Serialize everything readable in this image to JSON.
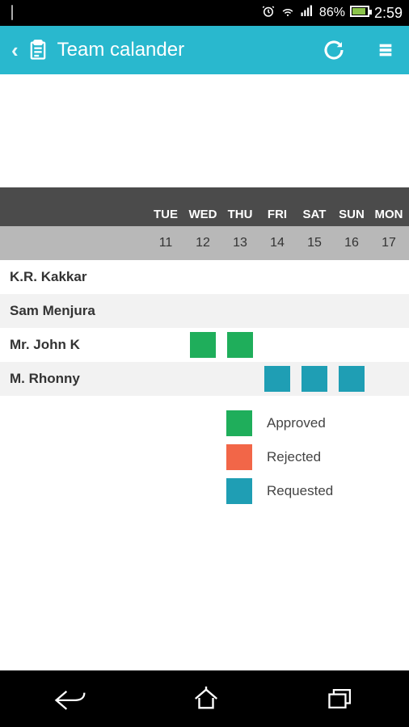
{
  "status": {
    "battery_pct": "86%",
    "time": "2:59"
  },
  "app_bar": {
    "title": "Team calander"
  },
  "calendar": {
    "days": [
      "TUE",
      "WED",
      "THU",
      "FRI",
      "SAT",
      "SUN",
      "MON"
    ],
    "dates": [
      "11",
      "12",
      "13",
      "14",
      "15",
      "16",
      "17"
    ],
    "rows": [
      {
        "name": "K.R. Kakkar",
        "cells": [
          "",
          "",
          "",
          "",
          "",
          "",
          ""
        ]
      },
      {
        "name": "Sam Menjura",
        "cells": [
          "",
          "",
          "",
          "",
          "",
          "",
          ""
        ]
      },
      {
        "name": "Mr. John K",
        "cells": [
          "",
          "approved",
          "approved",
          "",
          "",
          "",
          ""
        ]
      },
      {
        "name": "M. Rhonny",
        "cells": [
          "",
          "",
          "",
          "requested",
          "requested",
          "requested",
          ""
        ]
      }
    ]
  },
  "legend": {
    "approved": "Approved",
    "rejected": "Rejected",
    "requested": "Requested"
  },
  "colors": {
    "approved": "#1fae5b",
    "rejected": "#f26648",
    "requested": "#1f9eb4",
    "accent": "#29b8ce"
  }
}
